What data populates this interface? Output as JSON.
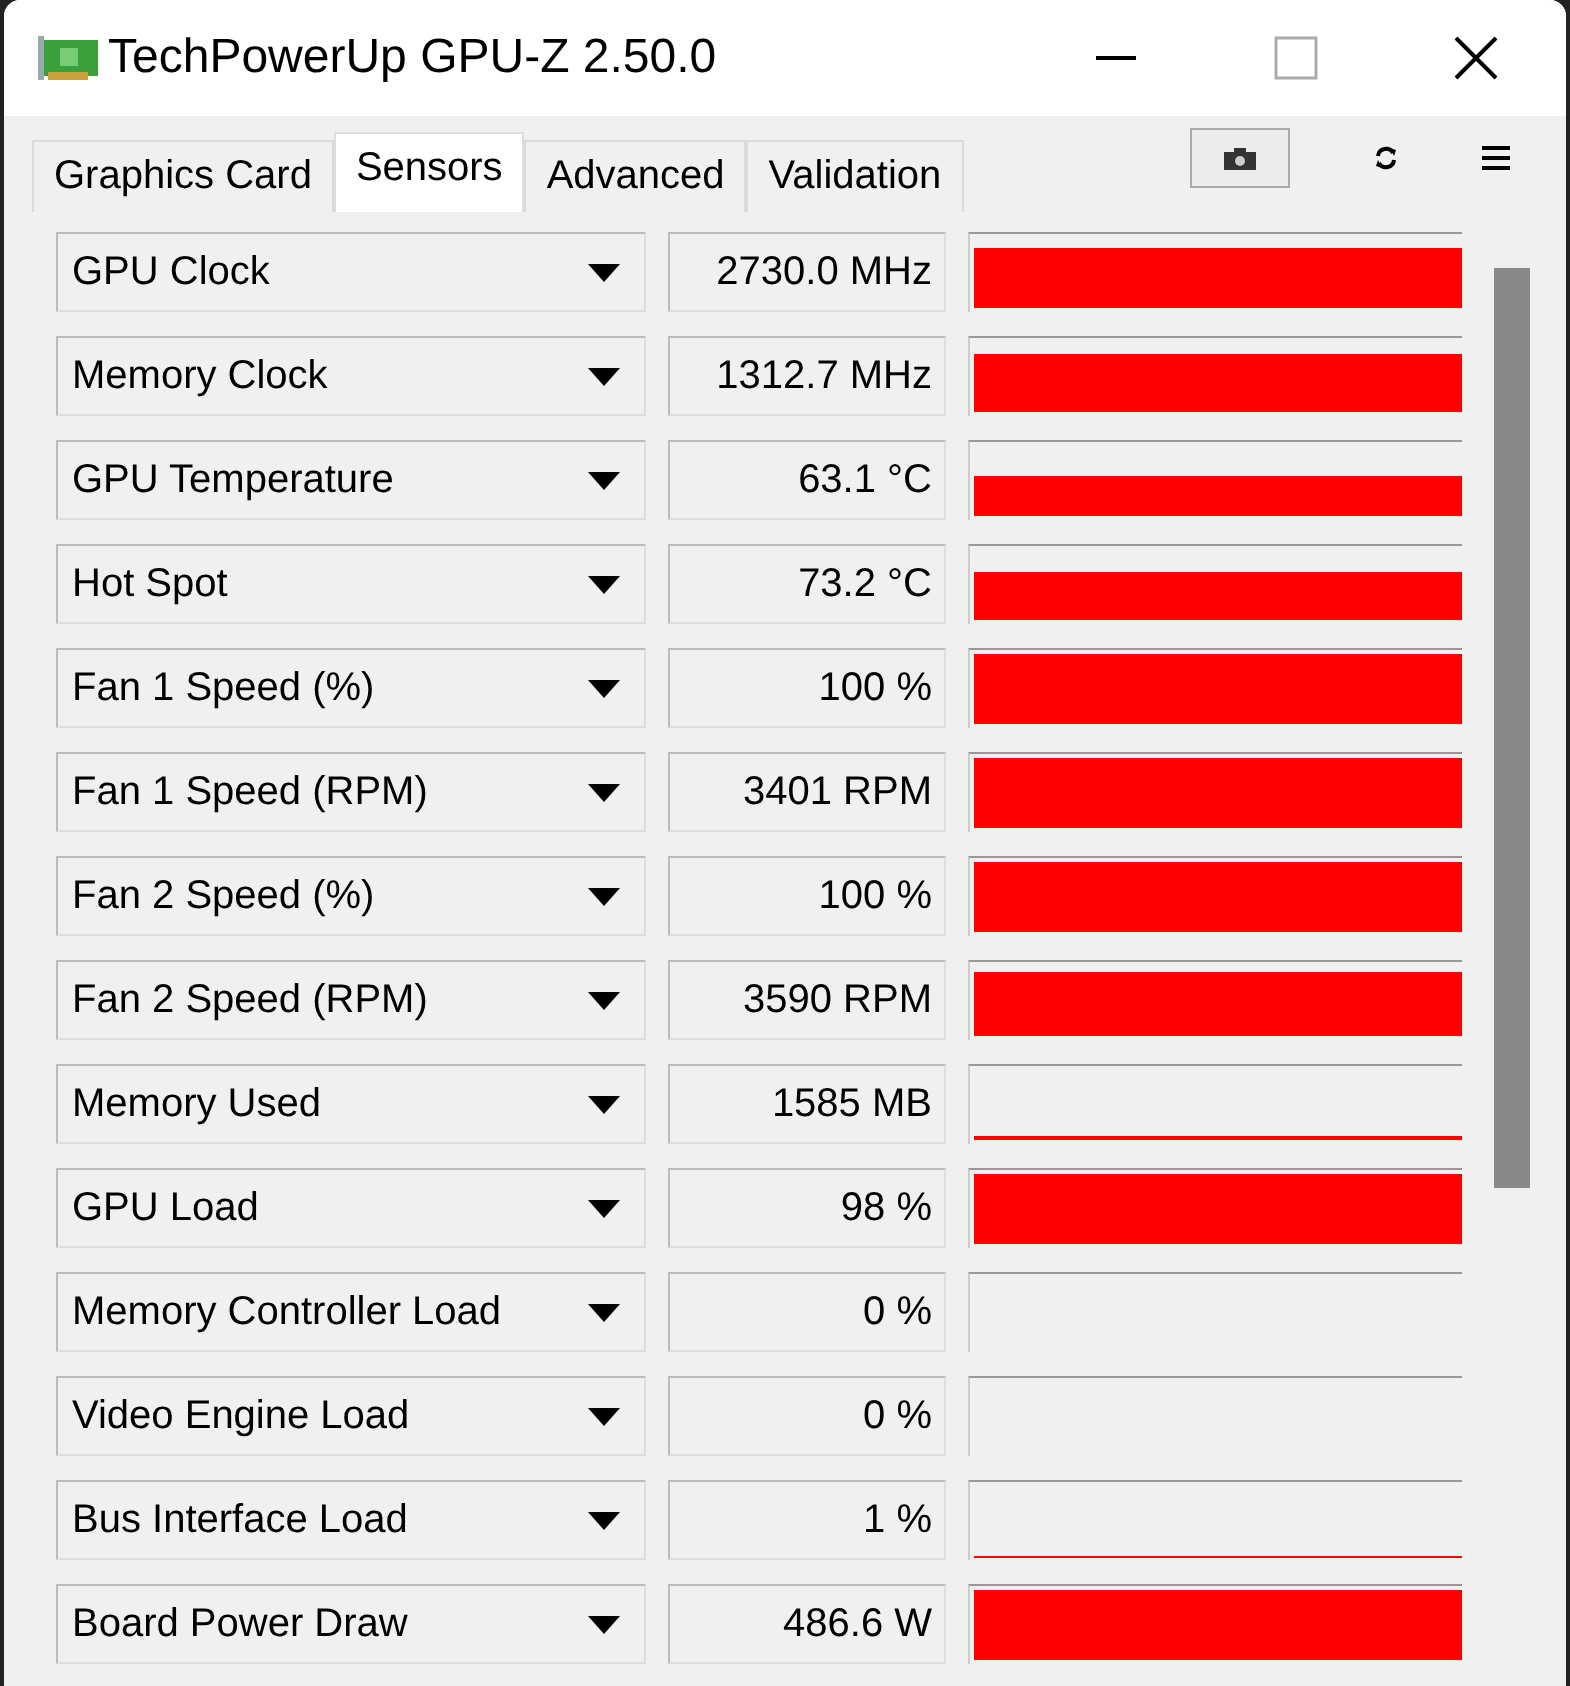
{
  "window": {
    "title": "TechPowerUp GPU-Z 2.50.0"
  },
  "tabs": [
    {
      "label": "Graphics Card",
      "selected": false
    },
    {
      "label": "Sensors",
      "selected": true
    },
    {
      "label": "Advanced",
      "selected": false
    },
    {
      "label": "Validation",
      "selected": false
    }
  ],
  "sensors": [
    {
      "name": "GPU Clock",
      "value": "2730.0 MHz"
    },
    {
      "name": "Memory Clock",
      "value": "1312.7 MHz"
    },
    {
      "name": "GPU Temperature",
      "value": "63.1 °C"
    },
    {
      "name": "Hot Spot",
      "value": "73.2 °C"
    },
    {
      "name": "Fan 1 Speed (%)",
      "value": "100 %"
    },
    {
      "name": "Fan 1 Speed (RPM)",
      "value": "3401 RPM"
    },
    {
      "name": "Fan 2 Speed (%)",
      "value": "100 %"
    },
    {
      "name": "Fan 2 Speed (RPM)",
      "value": "3590 RPM"
    },
    {
      "name": "Memory Used",
      "value": "1585 MB"
    },
    {
      "name": "GPU Load",
      "value": "98 %"
    },
    {
      "name": "Memory Controller Load",
      "value": "0 %"
    },
    {
      "name": "Video Engine Load",
      "value": "0 %"
    },
    {
      "name": "Bus Interface Load",
      "value": "1 %"
    },
    {
      "name": "Board Power Draw",
      "value": "486.6 W"
    }
  ]
}
